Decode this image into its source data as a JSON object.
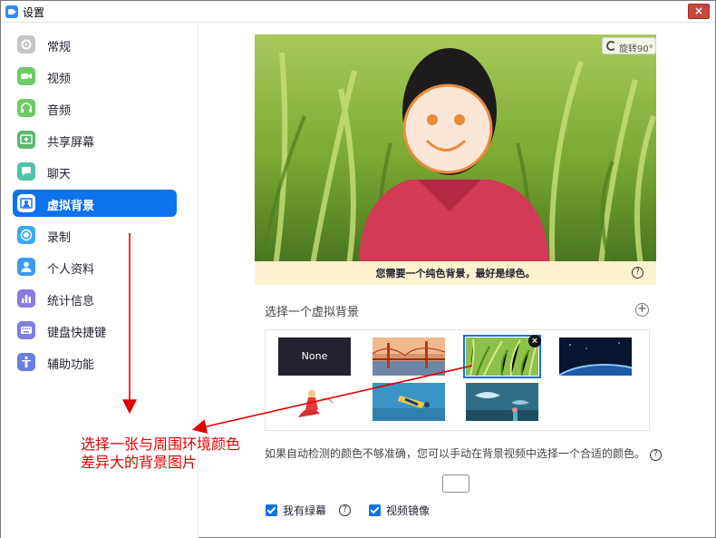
{
  "window": {
    "title": "设置",
    "close_glyph": "×"
  },
  "sidebar": {
    "items": [
      {
        "label": "常规",
        "icon": "gear-icon",
        "color": "#b5b5b5"
      },
      {
        "label": "视频",
        "icon": "video-camera-icon",
        "color": "#6ccc63"
      },
      {
        "label": "音频",
        "icon": "headphones-icon",
        "color": "#6ccc63"
      },
      {
        "label": "共享屏幕",
        "icon": "share-screen-icon",
        "color": "#58b86c"
      },
      {
        "label": "聊天",
        "icon": "chat-bubble-icon",
        "color": "#4cc3a8"
      },
      {
        "label": "虚拟背景",
        "icon": "virtual-background-icon",
        "color": "#0e72ed",
        "active": true
      },
      {
        "label": "录制",
        "icon": "record-icon",
        "color": "#3aa9f0"
      },
      {
        "label": "个人资料",
        "icon": "person-icon",
        "color": "#3b9bf2"
      },
      {
        "label": "统计信息",
        "icon": "statistics-icon",
        "color": "#8a7be3"
      },
      {
        "label": "键盘快捷键",
        "icon": "keyboard-icon",
        "color": "#7e7ee0"
      },
      {
        "label": "辅助功能",
        "icon": "accessibility-icon",
        "color": "#6b7de2"
      }
    ]
  },
  "preview": {
    "rotate_label": "旋转90°",
    "notice": "您需要一个纯色背景，最好是绿色。",
    "help_glyph": "?"
  },
  "backgrounds": {
    "section_title": "选择一个虚拟背景",
    "add_glyph": "+",
    "none_label": "None",
    "remove_glyph": "×"
  },
  "hint": {
    "text": "如果自动检测的颜色不够准确，您可以手动在背景视频中选择一个合适的颜色。",
    "help_glyph": "?"
  },
  "options": {
    "green_screen": {
      "label": "我有绿幕",
      "checked": true,
      "help_glyph": "?"
    },
    "mirror_video": {
      "label": "视频镜像",
      "checked": true
    }
  },
  "annotation": {
    "line1": "选择一张与周围环境颜色",
    "line2": "差异大的背景图片",
    "color": "#e00000"
  }
}
